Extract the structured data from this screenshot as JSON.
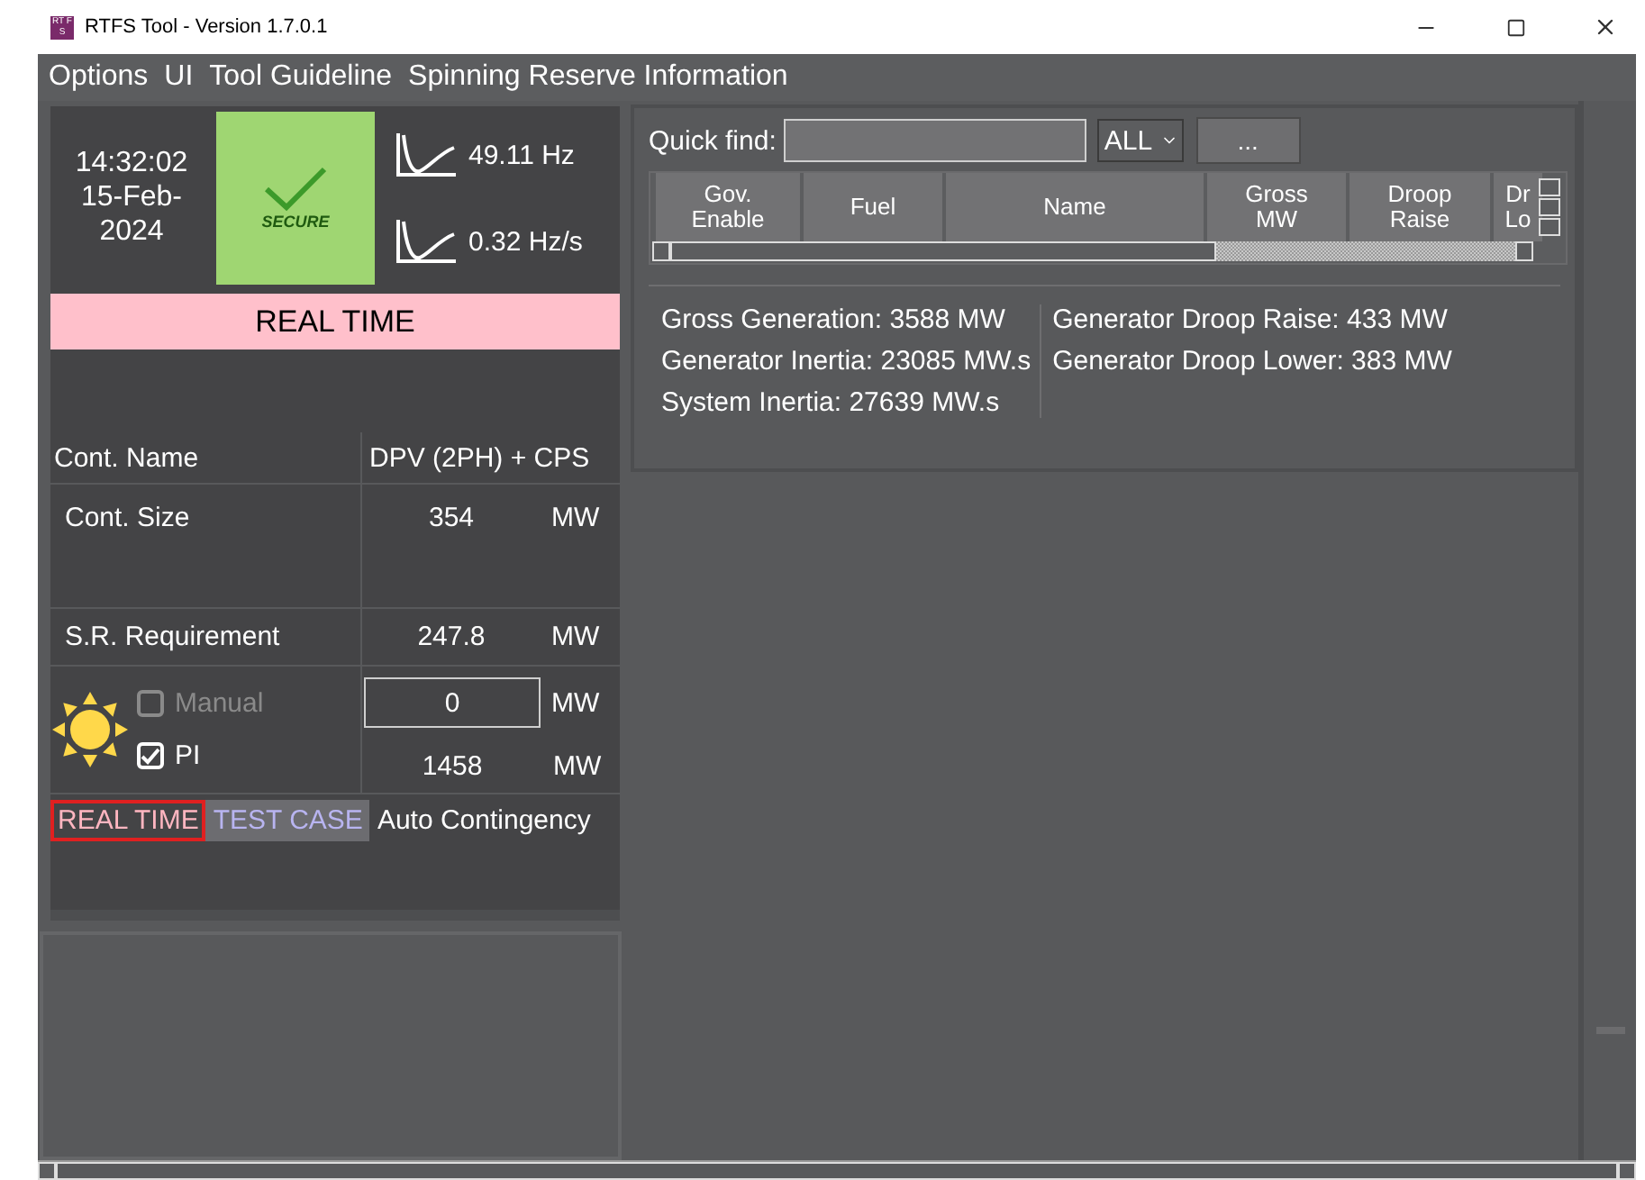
{
  "window": {
    "title": "RTFS Tool - Version 1.7.0.1",
    "app_icon": "RT FS"
  },
  "menu": [
    {
      "label": "Options"
    },
    {
      "label": "UI"
    },
    {
      "label": "Tool Guideline"
    },
    {
      "label": "Spinning Reserve Information"
    }
  ],
  "status": {
    "time": "14:32:02",
    "date": "15-Feb-2024",
    "security": {
      "label": "SECURE",
      "secure": true
    },
    "frequency": "49.11 Hz",
    "rocof": "0.32 Hz/s"
  },
  "mode_banner": "REAL TIME",
  "contingency": {
    "header": {
      "label": "Cont. Name",
      "value": "DPV (2PH) + CPS"
    },
    "rows": [
      {
        "label": "Cont. Size",
        "value": "354",
        "unit": "MW"
      },
      {
        "label": "S.R. Requirement",
        "value": "247.8",
        "unit": "MW"
      }
    ],
    "options": [
      {
        "kind": "input",
        "label": "Manual",
        "checked": false,
        "disabled": true,
        "value": "0",
        "unit": "MW"
      },
      {
        "kind": "text",
        "label": "PI",
        "checked": true,
        "disabled": false,
        "value": "1458",
        "unit": "MW"
      }
    ]
  },
  "mode_tabs": [
    {
      "label": "REAL TIME",
      "selected": true,
      "kind": "live"
    },
    {
      "label": "TEST CASE",
      "selected": false,
      "kind": "test"
    },
    {
      "label": "Auto Contingency",
      "selected": false,
      "kind": "auto"
    }
  ],
  "quick_find": {
    "label": "Quick find:",
    "filter": "ALL",
    "button": "..."
  },
  "generator_table": {
    "columns": [
      "Gov. Enable",
      "Fuel",
      "Name",
      "Gross MW",
      "Droop Raise",
      "Dr Lo"
    ]
  },
  "summary": {
    "left": [
      "Gross Generation: 3588 MW",
      "Generator Inertia: 23085 MW.s",
      "System Inertia: 27639 MW.s"
    ],
    "right": [
      "Generator Droop Raise: 433 MW",
      "Generator Droop Lower: 383 MW"
    ]
  }
}
